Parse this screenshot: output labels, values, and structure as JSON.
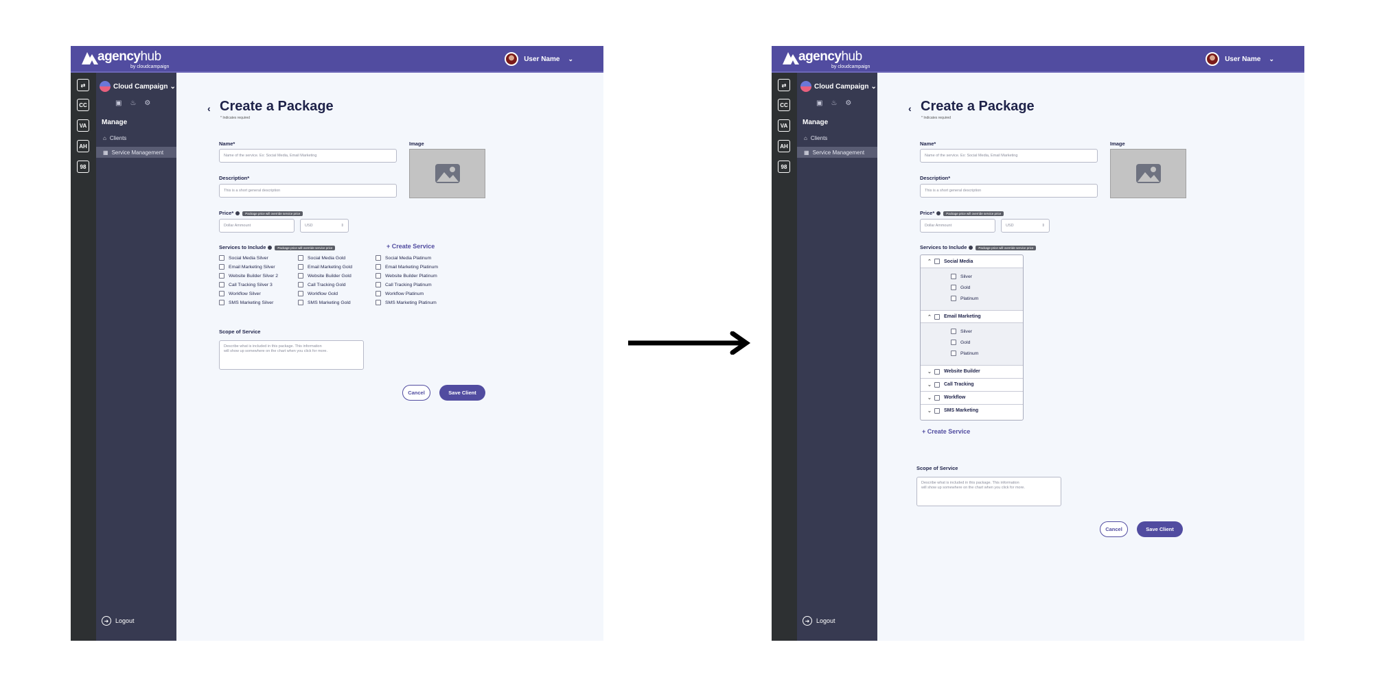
{
  "brand": {
    "name_bold": "agency",
    "name_light": "hub",
    "byline": "by cloudcampaign"
  },
  "user": {
    "name": "User Name"
  },
  "rail": [
    "CC",
    "VA",
    "AH",
    "98"
  ],
  "sidebar": {
    "workspace": "Cloud Campaign",
    "section": "Manage",
    "items": [
      {
        "label": "Clients",
        "icon": "home-icon"
      },
      {
        "label": "Service Management",
        "icon": "grid-icon"
      }
    ],
    "logout": "Logout"
  },
  "form": {
    "title": "Create a Package",
    "required_note": "* Indicates required",
    "name_label": "Name*",
    "name_placeholder": "Name of the service. Ex: Social Media, Email Marketing",
    "image_label": "Image",
    "description_label": "Description*",
    "description_placeholder": "This is a short general description",
    "price_label": "Price*",
    "price_tip": "Package price will override service price",
    "price_placeholder": "Dollar Ammount",
    "currency": "USD",
    "services_label": "Services to Include",
    "services_tip": "Package price will override service price",
    "create_service": "+ Create Service",
    "scope_label": "Scope of Service",
    "scope_placeholder_1": "Describe what is included in this package. This information",
    "scope_placeholder_2": "will show up somewhere on the chart when you click for more.",
    "cancel": "Cancel",
    "save": "Save Client"
  },
  "services_grid": [
    [
      "Social Media Silver",
      "Email Marketing Silver",
      "Website Builder Silver 2",
      "Call Tracking Silver 3",
      "Workflow Silver",
      "SMS Marketing Silver"
    ],
    [
      "Social Media Gold",
      "Email Marketing Gold",
      "Website Builder Gold",
      "Call Tracking Gold",
      "Workflow Gold",
      "SMS Marketing Gold"
    ],
    [
      "Social Media Platinum",
      "Email Marketing Platinum",
      "Website Builder Platinum",
      "Call Tracking Platinum",
      "Workflow Platinum",
      "SMS Marketing Platinum"
    ]
  ],
  "services_tree": {
    "groups": [
      "Social Media",
      "Email Marketing",
      "Website Builder",
      "Call Tracking",
      "Workflow",
      "SMS Marketing"
    ],
    "tiers": [
      "Silver",
      "Gold",
      "Platinum"
    ]
  },
  "colors": {
    "primary": "#514ca0",
    "sidebar": "#373a51",
    "rail": "#2d3032",
    "page": "#f4f7fc"
  }
}
